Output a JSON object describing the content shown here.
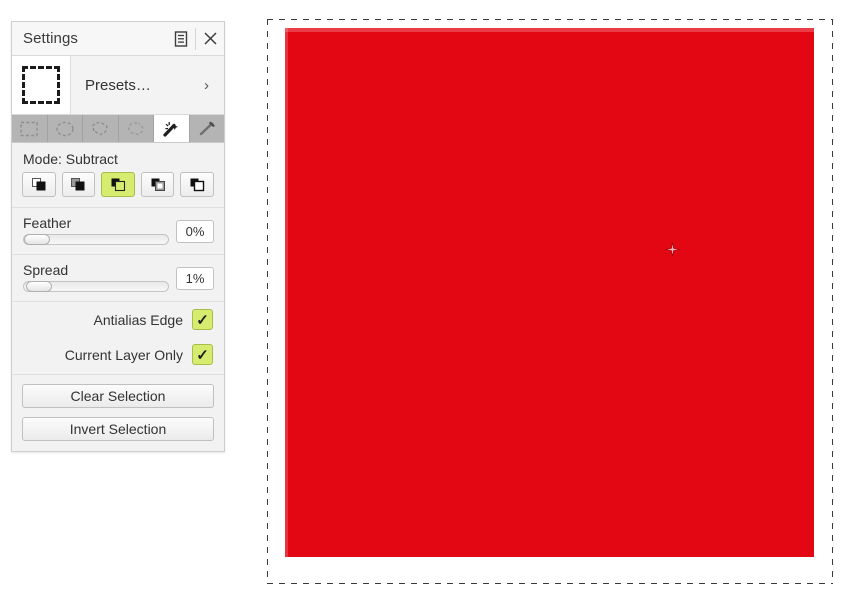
{
  "panel": {
    "title": "Settings",
    "titlebar_icons": [
      {
        "name": "list-icon",
        "glyph": "☰"
      },
      {
        "name": "close-icon",
        "glyph": "✕"
      }
    ],
    "presets": {
      "label": "Presets…",
      "chevron": "›",
      "thumbnail_icon": "dashed-square-icon"
    },
    "tool_tabs": [
      {
        "name": "rectangle-select",
        "active": false
      },
      {
        "name": "ellipse-select",
        "active": false
      },
      {
        "name": "polygon-lasso-select",
        "active": false
      },
      {
        "name": "lasso-select",
        "active": false
      },
      {
        "name": "magic-wand-select",
        "active": true
      },
      {
        "name": "wand-tool",
        "active": false
      }
    ],
    "mode": {
      "label": "Mode: Subtract",
      "buttons": [
        {
          "name": "replace-mode",
          "selected": false
        },
        {
          "name": "union-mode",
          "selected": false
        },
        {
          "name": "subtract-mode",
          "selected": true
        },
        {
          "name": "intersect-mode",
          "selected": false
        },
        {
          "name": "xor-mode",
          "selected": false
        }
      ]
    },
    "sliders": [
      {
        "name": "feather",
        "label": "Feather",
        "value": "0%",
        "fill_percent": 0
      },
      {
        "name": "spread",
        "label": "Spread",
        "value": "1%",
        "fill_percent": 1
      }
    ],
    "checkboxes": [
      {
        "name": "antialias-edge",
        "label": "Antialias Edge",
        "checked": true,
        "mark": "✓"
      },
      {
        "name": "current-layer-only",
        "label": "Current Layer Only",
        "checked": true,
        "mark": "✓"
      }
    ],
    "actions": [
      {
        "name": "clear-selection",
        "label": "Clear Selection"
      },
      {
        "name": "invert-selection",
        "label": "Invert Selection"
      }
    ]
  },
  "canvas": {
    "layer_color": "#e30613",
    "selection_marquee_color": "#3a3a3a",
    "cursor_icon": "crosshair-cursor"
  },
  "colors": {
    "accent_selected": "#d6ec6f",
    "accent_selected_border": "#a8bd4c",
    "panel_bg": "#f2f2f2",
    "tab_bar_bg": "#b4b4b4",
    "red": "#e30613"
  }
}
